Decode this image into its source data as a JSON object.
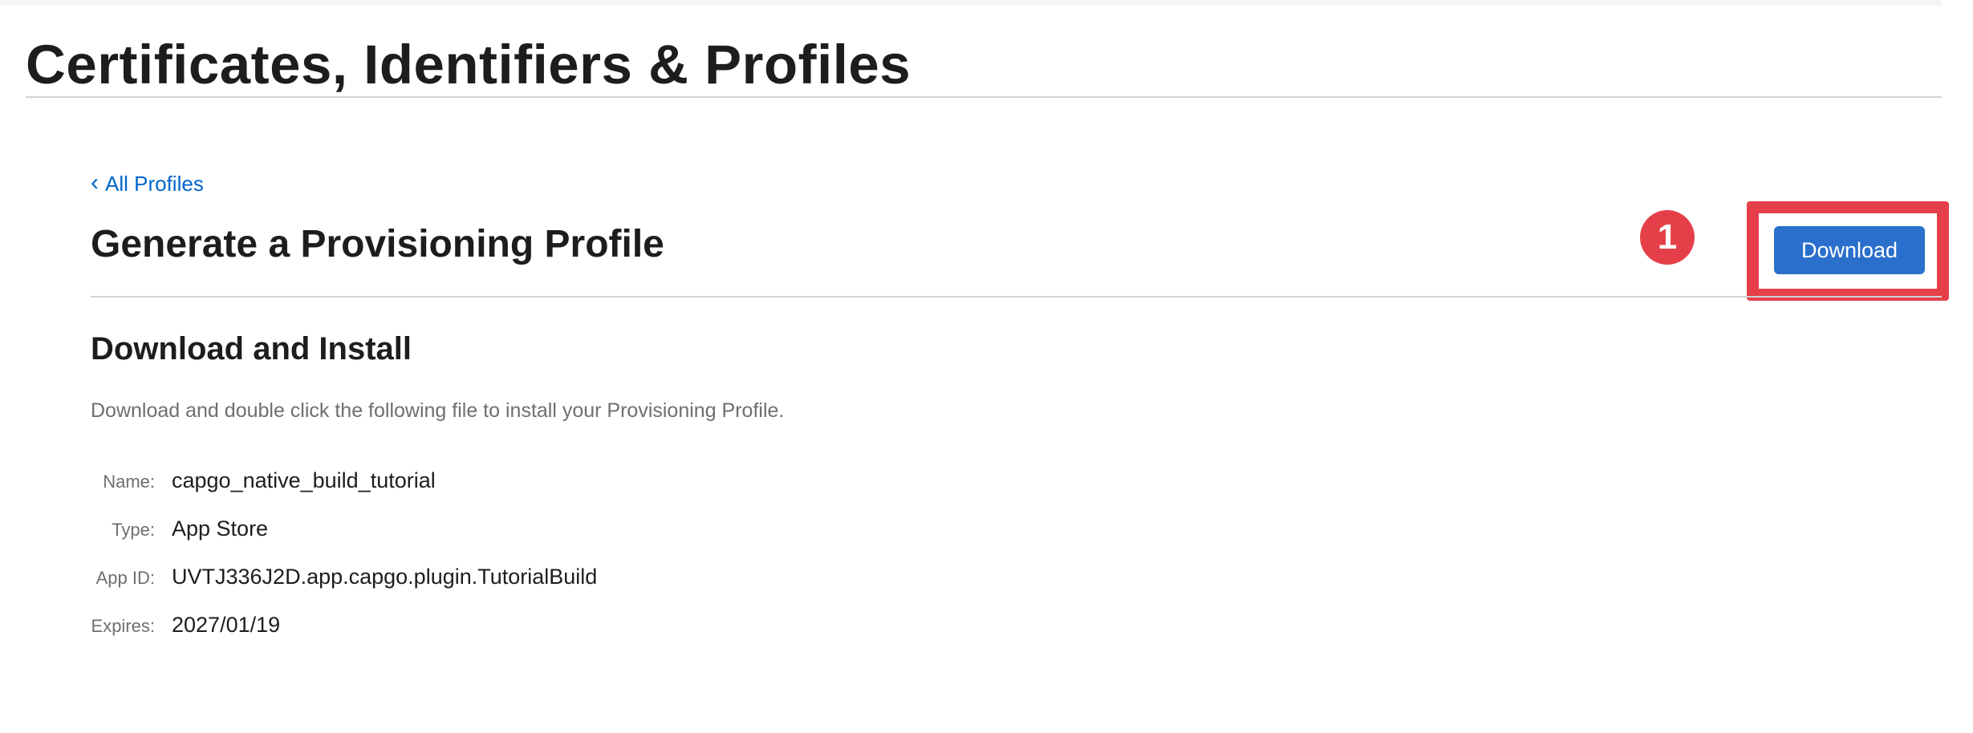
{
  "header": {
    "title": "Certificates, Identifiers & Profiles"
  },
  "nav": {
    "back_link_label": "All Profiles",
    "back_chevron": "‹"
  },
  "section": {
    "title": "Generate a Provisioning Profile",
    "download_button_label": "Download",
    "callout_number": "1"
  },
  "content": {
    "heading": "Download and Install",
    "description": "Download and double click the following file to install your Provisioning Profile.",
    "details": [
      {
        "label": "Name:",
        "value": "capgo_native_build_tutorial"
      },
      {
        "label": "Type:",
        "value": "App Store"
      },
      {
        "label": "App ID:",
        "value": "UVTJ336J2D.app.capgo.plugin.TutorialBuild"
      },
      {
        "label": "Expires:",
        "value": "2027/01/19"
      }
    ]
  },
  "colors": {
    "accent_blue": "#2a6fcb",
    "link_blue": "#0066cc",
    "highlight_red": "#e5404a"
  }
}
